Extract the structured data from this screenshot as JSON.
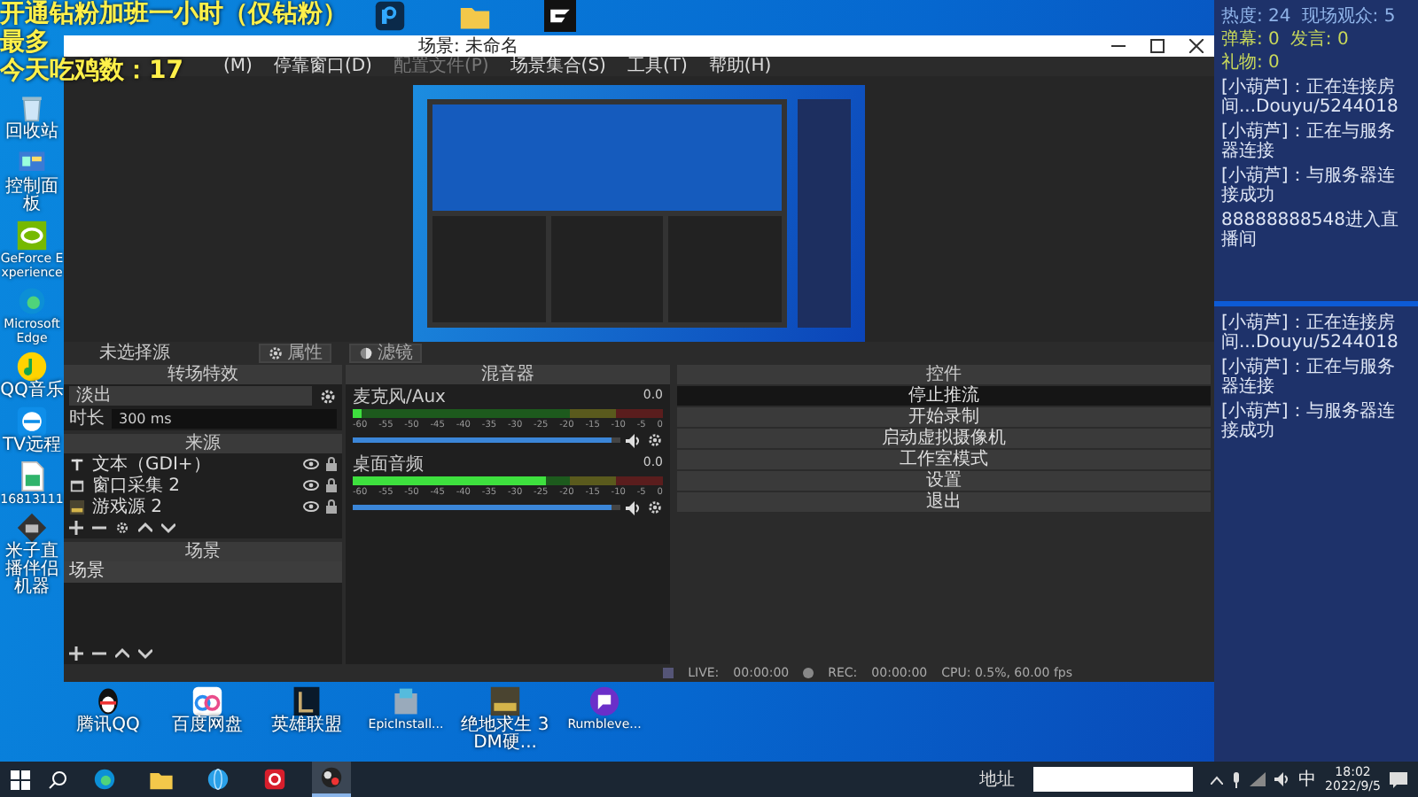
{
  "overlay": {
    "lines": [
      "开通钻粉加班一小时（仅钻粉）",
      "最多",
      "今天吃鸡数：17"
    ]
  },
  "top_icons": [
    {
      "kind": "ps"
    },
    {
      "kind": "folder"
    },
    {
      "kind": "gp"
    }
  ],
  "desktop_icons": [
    {
      "kind": "bin",
      "label": "回收站"
    },
    {
      "kind": "panel",
      "label": "控制面板"
    },
    {
      "kind": "nvidia",
      "label": "GeForce Experience"
    },
    {
      "kind": "edge",
      "label": "Microsoft Edge"
    },
    {
      "kind": "music",
      "label": "QQ音乐"
    },
    {
      "kind": "remote",
      "label": "TV远程"
    },
    {
      "kind": "sheet",
      "label": "16813111"
    },
    {
      "kind": "app",
      "label": "米子直播伴侣机器"
    }
  ],
  "obs": {
    "title": "场景: 未命名",
    "menu": [
      "(M)",
      "停靠窗口(D)",
      "配置文件(P)",
      "场景集合(S)",
      "工具(T)",
      "帮助(H)"
    ],
    "source_bar": {
      "label": "未选择源",
      "buttons": [
        {
          "kind": "gear",
          "label": "属性"
        },
        {
          "kind": "filter",
          "label": "滤镜"
        }
      ]
    },
    "transitions": {
      "title": "转场特效",
      "type": "淡出",
      "duration_label": "时长",
      "duration": "300 ms"
    },
    "sources": {
      "title": "来源",
      "items": [
        {
          "kind": "text",
          "name": "文本（GDI+）"
        },
        {
          "kind": "window",
          "name": "窗口采集 2"
        },
        {
          "kind": "game",
          "name": "游戏源 2"
        }
      ]
    },
    "scenes": {
      "title": "场景",
      "items": [
        {
          "name": "场景",
          "selected": true
        }
      ]
    },
    "mixer": {
      "title": "混音器",
      "channels": [
        {
          "name": "麦克风/Aux",
          "reading": "0.0",
          "level": 0.03,
          "volume": {
            "level": 0.97
          },
          "scale": [
            "-60",
            "-55",
            "-50",
            "-45",
            "-40",
            "-35",
            "-30",
            "-25",
            "-20",
            "-15",
            "-10",
            "-5",
            "0"
          ]
        },
        {
          "name": "桌面音频",
          "reading": "0.0",
          "level": 0.62,
          "volume": {
            "level": 0.97
          },
          "scale": [
            "-60",
            "-55",
            "-50",
            "-45",
            "-40",
            "-35",
            "-30",
            "-25",
            "-20",
            "-15",
            "-10",
            "-5",
            "0"
          ]
        }
      ]
    },
    "controls": {
      "title": "控件",
      "buttons": [
        {
          "label": "停止推流",
          "selected": true
        },
        {
          "label": "开始录制",
          "selected": false
        },
        {
          "label": "启动虚拟摄像机",
          "selected": false
        },
        {
          "label": "工作室模式",
          "selected": false
        },
        {
          "label": "设置",
          "selected": false
        },
        {
          "label": "退出",
          "selected": false
        }
      ]
    },
    "status": {
      "items": [
        {
          "kind": "live",
          "label": "LIVE:",
          "time": "00:00:00"
        },
        {
          "kind": "rec",
          "label": "REC:",
          "time": "00:00:00"
        }
      ],
      "cpu": "CPU: 0.5%, 60.00 fps"
    }
  },
  "bottom_icons": [
    {
      "kind": "qq",
      "label": "腾讯QQ"
    },
    {
      "kind": "cloud",
      "label": "百度网盘"
    },
    {
      "kind": "lol",
      "label": "英雄联盟"
    },
    {
      "kind": "installer",
      "label": "EpicInstall..."
    },
    {
      "kind": "game",
      "label": "绝地求生 3DM硬..."
    },
    {
      "kind": "rumble",
      "label": "Rumbleve..."
    }
  ],
  "chat": {
    "stats": [
      {
        "label": "热度: 24",
        "color": "#8fb3e8"
      },
      {
        "label": "现场观众: 5",
        "color": "#8fb3e8"
      },
      {
        "label": "弹幕: 0",
        "color": "#c8d85a"
      },
      {
        "label": "发言: 0",
        "color": "#c8d85a"
      },
      {
        "label": "礼物: 0",
        "color": "#c8d85a"
      }
    ],
    "messages": [
      "[小葫芦]：正在连接房间...Douyu/5244018",
      "[小葫芦]：正在与服务器连接",
      "[小葫芦]：与服务器连接成功",
      "88888888548进入直播间"
    ],
    "log": [
      "[小葫芦]：正在连接房间...Douyu/5244018",
      "[小葫芦]：正在与服务器连接",
      "[小葫芦]：与服务器连接成功"
    ]
  },
  "taskbar": {
    "apps": [
      {
        "kind": "edge",
        "selected": false
      },
      {
        "kind": "folder",
        "selected": false
      },
      {
        "kind": "globe",
        "selected": false
      },
      {
        "kind": "netease",
        "selected": false
      },
      {
        "kind": "obs",
        "selected": true
      }
    ],
    "address_label": "地址",
    "ime": "中",
    "time": "18:02",
    "date": "2022/9/5"
  }
}
